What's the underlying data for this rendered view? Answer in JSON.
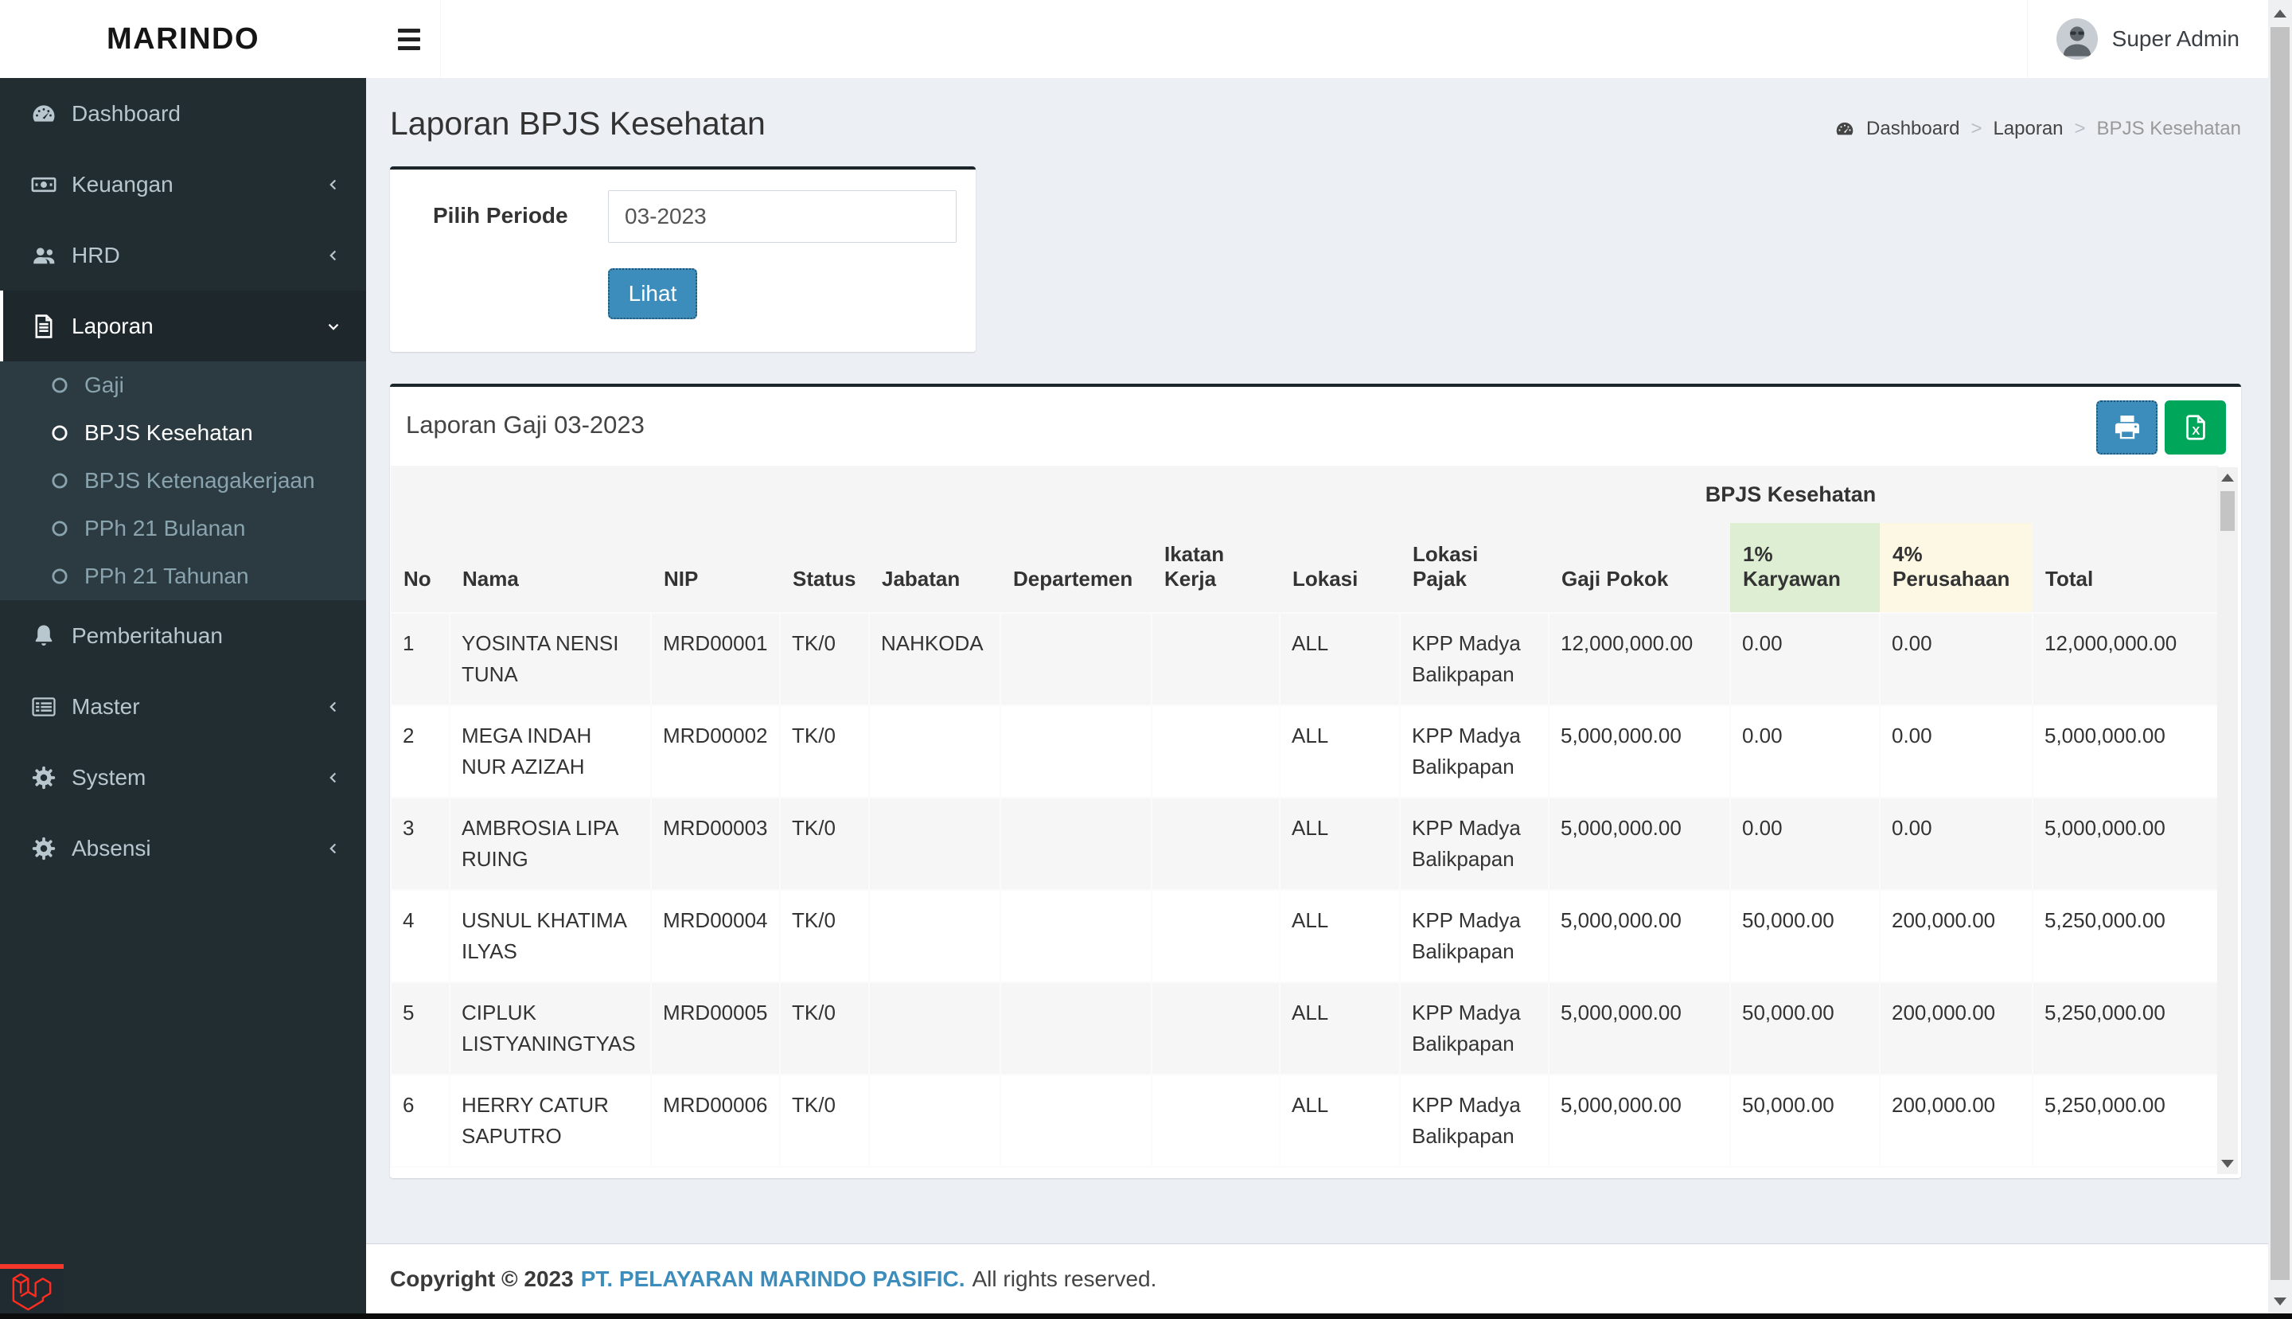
{
  "brand": "MARINDO",
  "header": {
    "user_name": "Super Admin",
    "avatar_icon": "user-photo"
  },
  "page": {
    "title": "Laporan BPJS Kesehatan",
    "breadcrumb": {
      "home": "Dashboard",
      "section": "Laporan",
      "current": "BPJS Kesehatan",
      "home_icon": "dashboard-icon"
    }
  },
  "sidebar": {
    "items": [
      {
        "label": "Dashboard",
        "icon": "tachometer-icon",
        "chevron": null,
        "active": false
      },
      {
        "label": "Keuangan",
        "icon": "money-icon",
        "chevron": "left",
        "active": false
      },
      {
        "label": "HRD",
        "icon": "users-icon",
        "chevron": "left",
        "active": false
      },
      {
        "label": "Laporan",
        "icon": "file-text-icon",
        "chevron": "down",
        "active": true,
        "submenu": [
          {
            "label": "Gaji",
            "active": false
          },
          {
            "label": "BPJS Kesehatan",
            "active": true
          },
          {
            "label": "BPJS Ketenagakerjaan",
            "active": false
          },
          {
            "label": "PPh 21 Bulanan",
            "active": false
          },
          {
            "label": "PPh 21 Tahunan",
            "active": false
          }
        ]
      },
      {
        "label": "Pemberitahuan",
        "icon": "bell-icon",
        "chevron": null,
        "active": false
      },
      {
        "label": "Master",
        "icon": "th-list-icon",
        "chevron": "left",
        "active": false
      },
      {
        "label": "System",
        "icon": "gear-icon",
        "chevron": "left",
        "active": false
      },
      {
        "label": "Absensi",
        "icon": "gear-icon",
        "chevron": "left",
        "active": false
      }
    ]
  },
  "filter": {
    "label": "Pilih Periode",
    "value": "03-2023",
    "button": "Lihat"
  },
  "report": {
    "title": "Laporan Gaji 03-2023",
    "group_header": "BPJS Kesehatan",
    "toolbar": {
      "print_icon": "printer-icon",
      "excel_icon": "file-excel-icon"
    },
    "columns": [
      "No",
      "Nama",
      "NIP",
      "Status",
      "Jabatan",
      "Departemen",
      "Ikatan Kerja",
      "Lokasi",
      "Lokasi Pajak",
      "Gaji Pokok",
      "1% Karyawan",
      "4% Perusahaan",
      "Total"
    ],
    "rows": [
      [
        "1",
        "YOSINTA NENSI TUNA",
        "MRD00001",
        "TK/0",
        "NAHKODA",
        "",
        "",
        "ALL",
        "KPP Madya Balikpapan",
        "12,000,000.00",
        "0.00",
        "0.00",
        "12,000,000.00"
      ],
      [
        "2",
        "MEGA INDAH NUR AZIZAH",
        "MRD00002",
        "TK/0",
        "",
        "",
        "",
        "ALL",
        "KPP Madya Balikpapan",
        "5,000,000.00",
        "0.00",
        "0.00",
        "5,000,000.00"
      ],
      [
        "3",
        "AMBROSIA LIPA RUING",
        "MRD00003",
        "TK/0",
        "",
        "",
        "",
        "ALL",
        "KPP Madya Balikpapan",
        "5,000,000.00",
        "0.00",
        "0.00",
        "5,000,000.00"
      ],
      [
        "4",
        "USNUL KHATIMA ILYAS",
        "MRD00004",
        "TK/0",
        "",
        "",
        "",
        "ALL",
        "KPP Madya Balikpapan",
        "5,000,000.00",
        "50,000.00",
        "200,000.00",
        "5,250,000.00"
      ],
      [
        "5",
        "CIPLUK LISTYANINGTYAS",
        "MRD00005",
        "TK/0",
        "",
        "",
        "",
        "ALL",
        "KPP Madya Balikpapan",
        "5,000,000.00",
        "50,000.00",
        "200,000.00",
        "5,250,000.00"
      ],
      [
        "6",
        "HERRY CATUR SAPUTRO",
        "MRD00006",
        "TK/0",
        "",
        "",
        "",
        "ALL",
        "KPP Madya Balikpapan",
        "5,000,000.00",
        "50,000.00",
        "200,000.00",
        "5,250,000.00"
      ]
    ]
  },
  "footer": {
    "copyright_prefix": "Copyright © 2023",
    "company": "PT. PELAYARAN MARINDO PASIFIC.",
    "suffix": "All rights reserved."
  },
  "colors": {
    "primary": "#3c8dbc",
    "success": "#00a65a",
    "sidebar": "#222d32",
    "sidebar_submenu": "#2c3b41",
    "content_bg": "#ecf0f5",
    "card_top_border": "#1c2529",
    "header_karyawan_bg": "#ddeed3",
    "header_perusahaan_bg": "#fcf8e3",
    "laravel_red": "#ff2d20"
  }
}
